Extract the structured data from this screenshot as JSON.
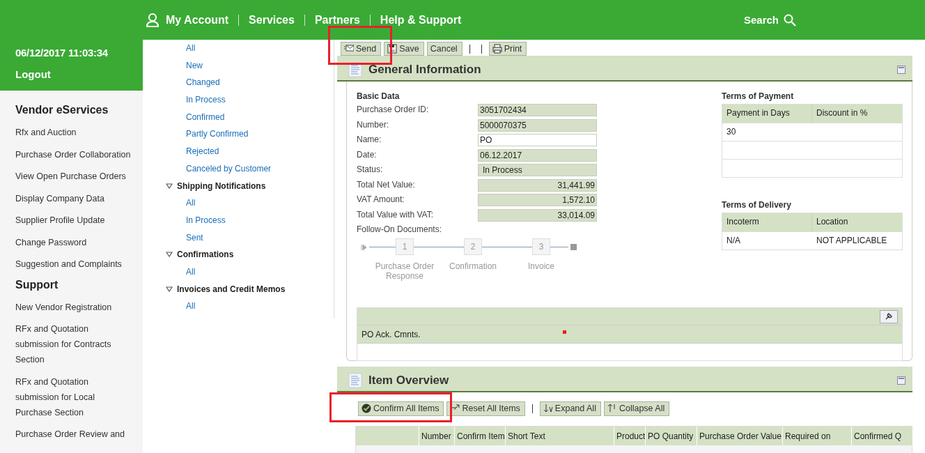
{
  "top_nav": {
    "items": [
      "My Account",
      "Services",
      "Partners",
      "Help & Support"
    ],
    "search": "Search"
  },
  "session": {
    "datetime": "06/12/2017 11:03:34",
    "logout": "Logout"
  },
  "sidebar": {
    "sections": [
      {
        "title": "Vendor eServices",
        "items": [
          "Rfx and Auction",
          "Purchase Order Collaboration",
          "View Open Purchase Orders",
          "Display Company Data",
          "Supplier Profile Update",
          "Change Password",
          "Suggestion and Complaints"
        ]
      },
      {
        "title": "Support",
        "items": [
          "New Vendor Registration",
          "RFx and Quotation submission for Contracts Section",
          "RFx and Quotation submission for Local Purchase Section",
          "Purchase Order Review and"
        ]
      }
    ]
  },
  "tree": {
    "groups": [
      {
        "items": [
          "All",
          "New",
          "Changed",
          "In Process",
          "Confirmed",
          "Partly Confirmed",
          "Rejected",
          "Canceled by Customer"
        ]
      },
      {
        "title": "Shipping Notifications",
        "expanded": true,
        "items": [
          "All",
          "In Process",
          "Sent"
        ]
      },
      {
        "title": "Confirmations",
        "expanded": true,
        "items": [
          "All"
        ]
      },
      {
        "title": "Invoices and Credit Memos",
        "expanded": true,
        "items": [
          "All"
        ]
      }
    ]
  },
  "toolbar": [
    {
      "kind": "send",
      "label": "Send"
    },
    {
      "kind": "save",
      "label": "Save"
    },
    {
      "kind": "plain",
      "label": "Cancel"
    },
    {
      "kind": "separator"
    },
    {
      "kind": "separator"
    },
    {
      "kind": "print",
      "label": "Print"
    }
  ],
  "general_information": {
    "title": "General Information",
    "basic_data": {
      "title": "Basic Data",
      "fields": [
        {
          "label": "Purchase Order ID:",
          "value": "3051702434",
          "kind": "text",
          "editable": false
        },
        {
          "label": "Number:",
          "value": "5000070375",
          "kind": "text",
          "editable": false
        },
        {
          "label": "Name:",
          "value": "PO",
          "kind": "text",
          "editable": true
        },
        {
          "label": "Date:",
          "value": "06.12.2017",
          "kind": "text",
          "editable": false
        },
        {
          "label": "Status:",
          "value": "In Process",
          "kind": "status",
          "editable": false
        },
        {
          "label": "Total Net Value:",
          "value": "31,441.99",
          "kind": "amount",
          "editable": false
        },
        {
          "label": "VAT Amount:",
          "value": "1,572.10",
          "kind": "amount",
          "editable": false
        },
        {
          "label": "Total Value with VAT:",
          "value": "33,014.09",
          "kind": "amount",
          "editable": false
        }
      ]
    },
    "follow_on": {
      "label": "Follow-On Documents:",
      "steps": [
        {
          "number": "1",
          "label": "Purchase Order Response"
        },
        {
          "number": "2",
          "label": "Confirmation"
        },
        {
          "number": "3",
          "label": "Invoice"
        }
      ]
    },
    "terms_of_payment": {
      "title": "Terms of Payment",
      "columns": [
        "Payment in Days",
        "Discount in %"
      ],
      "rows": [
        [
          "30"
        ]
      ]
    },
    "terms_of_delivery": {
      "title": "Terms of Delivery",
      "columns": [
        "Incoterm",
        "Location"
      ],
      "rows": [
        [
          "N/A",
          "NOT APPLICABLE"
        ]
      ]
    },
    "comments": {
      "label": "PO Ack. Cmnts."
    }
  },
  "item_overview": {
    "title": "Item Overview",
    "buttons": [
      {
        "kind": "confirm",
        "label": "Confirm All Items"
      },
      {
        "kind": "reset",
        "label": "Reset All Items"
      },
      {
        "kind": "separator"
      },
      {
        "kind": "expand",
        "label": "Expand All"
      },
      {
        "kind": "collapse",
        "label": "Collapse All"
      }
    ],
    "columns": [
      "Number",
      "Confirm Item",
      "Short Text",
      "Product",
      "PO Quantity",
      "Purchase Order Value",
      "Required on",
      "Confirmed Q"
    ]
  }
}
